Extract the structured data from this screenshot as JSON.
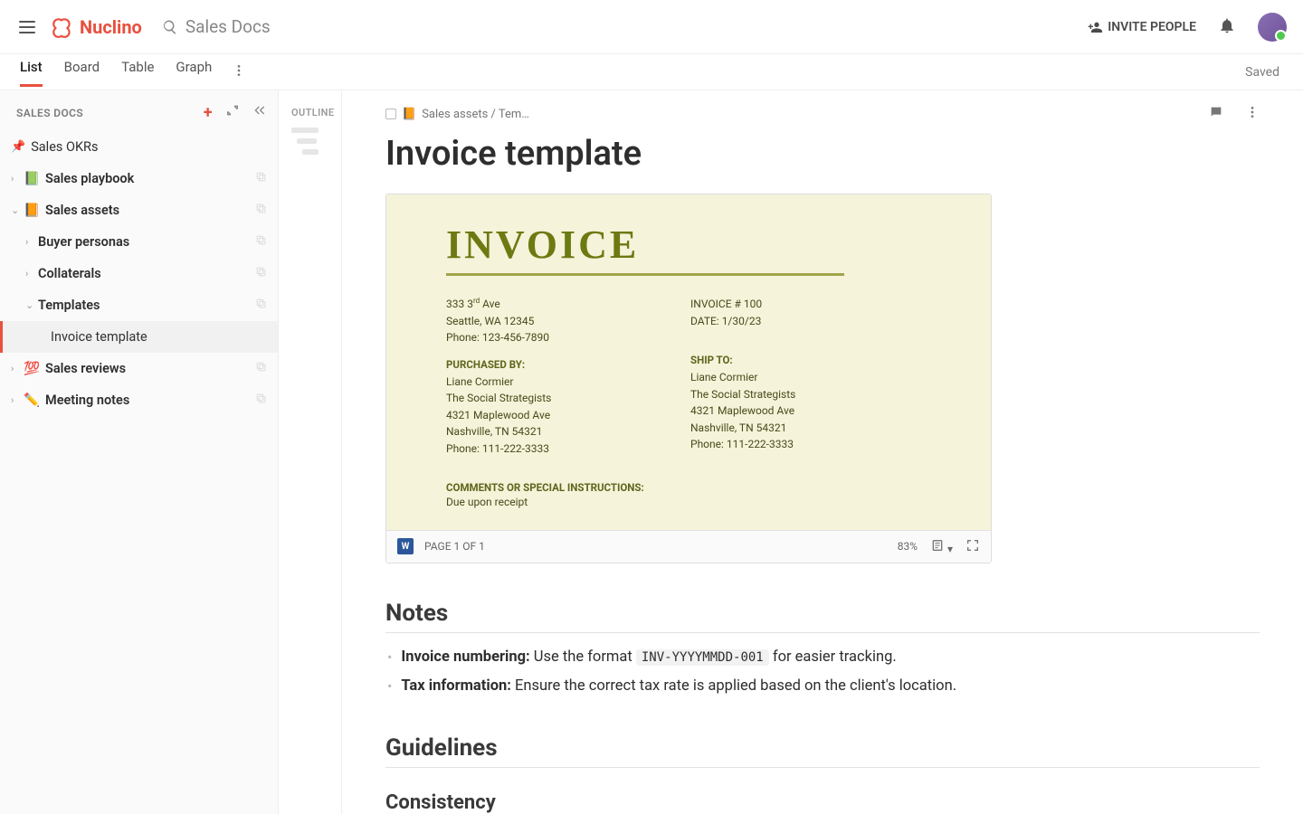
{
  "header": {
    "app_name": "Nuclino",
    "search_label": "Sales Docs",
    "invite_label": "INVITE PEOPLE"
  },
  "viewtabs": {
    "tabs": [
      "List",
      "Board",
      "Table",
      "Graph"
    ],
    "active": "List",
    "saved_label": "Saved"
  },
  "sidebar": {
    "title": "SALES DOCS",
    "items": [
      {
        "label": "Sales OKRs",
        "pin": true
      },
      {
        "label": "Sales playbook",
        "emoji": "📗",
        "chev": "›"
      },
      {
        "label": "Sales assets",
        "emoji": "📙",
        "chev": "⌄",
        "children": [
          {
            "label": "Buyer personas",
            "chev": "›"
          },
          {
            "label": "Collaterals",
            "chev": "›"
          },
          {
            "label": "Templates",
            "chev": "⌄",
            "children": [
              {
                "label": "Invoice template",
                "active": true
              }
            ]
          }
        ]
      },
      {
        "label": "Sales reviews",
        "emoji": "💯",
        "chev": "›"
      },
      {
        "label": "Meeting notes",
        "emoji": "✏️",
        "chev": "›"
      }
    ]
  },
  "outline": {
    "label": "OUTLINE"
  },
  "doc": {
    "breadcrumb_emoji": "📙",
    "breadcrumb": "Sales assets / Tem…",
    "title": "Invoice template",
    "preview": {
      "heading": "INVOICE",
      "from": {
        "addr1": "333 3rd Ave",
        "addr2": "Seattle, WA 12345",
        "phone": "Phone: 123-456-7890"
      },
      "meta": {
        "invoice_no": "INVOICE # 100",
        "date": "DATE: 1/30/23"
      },
      "purchased_by_label": "PURCHASED BY:",
      "ship_to_label": "SHIP TO:",
      "customer": {
        "name": "Liane Cormier",
        "company": "The Social Strategists",
        "addr": "4321 Maplewood Ave",
        "city": "Nashville, TN 54321",
        "phone": "Phone: 111-222-3333"
      },
      "comments_label": "COMMENTS OR SPECIAL INSTRUCTIONS:",
      "comments_body": "Due upon receipt",
      "footer": {
        "page": "PAGE 1 OF 1",
        "zoom": "83%"
      }
    },
    "notes_heading": "Notes",
    "notes": [
      {
        "bold": "Invoice numbering:",
        "text": " Use the format ",
        "code": "INV-YYYYMMDD-001",
        "tail": " for easier tracking."
      },
      {
        "bold": "Tax information:",
        "text": " Ensure the correct tax rate is applied based on the client's location."
      }
    ],
    "guidelines_heading": "Guidelines",
    "consistency_heading": "Consistency"
  }
}
